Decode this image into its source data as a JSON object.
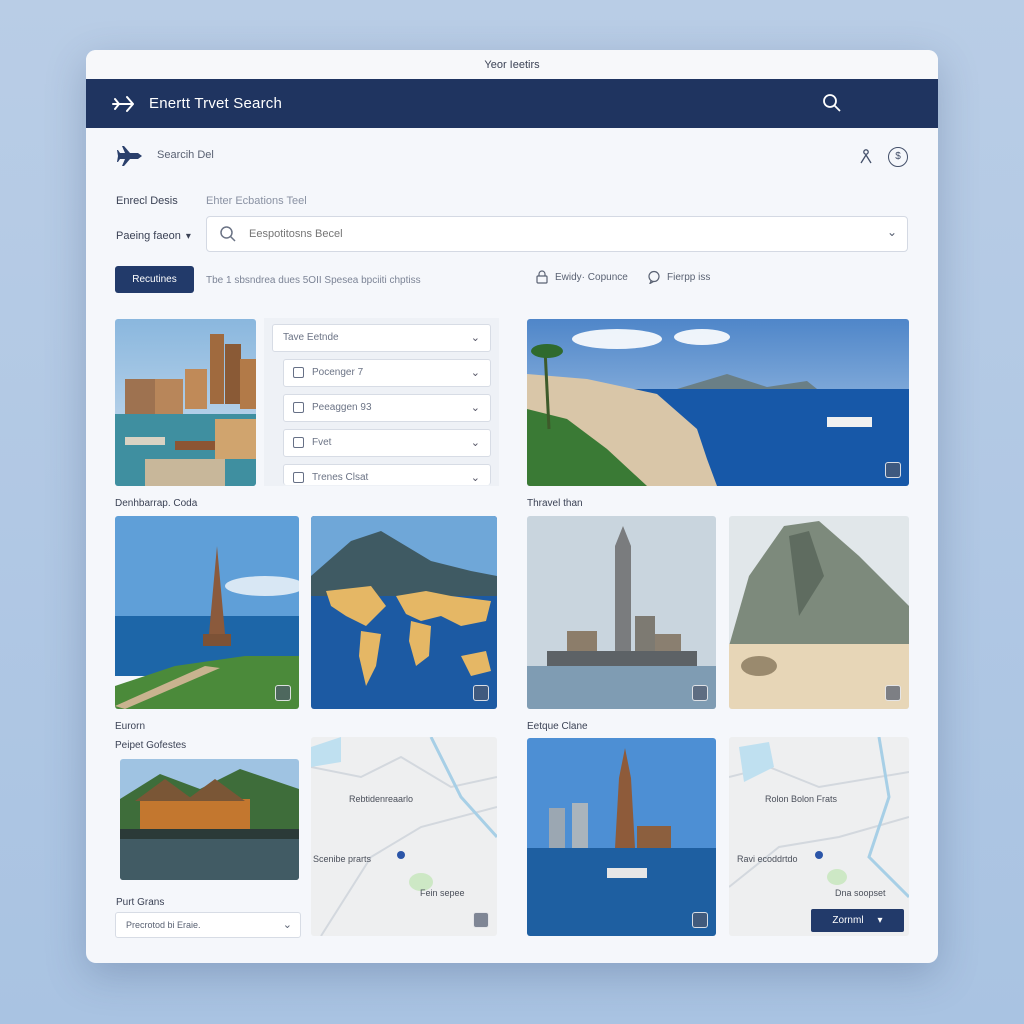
{
  "window": {
    "title": "Yeor Ieetirs"
  },
  "appbar": {
    "title": "Enertt Trvet Search"
  },
  "subheader": {
    "label": "Searcih Del"
  },
  "destination": {
    "label": "Enrecl Desis",
    "hint": "Ehter Ecbations Teel"
  },
  "filter": {
    "label": "Paeing faeon"
  },
  "search": {
    "placeholder": "Eespotitosns Becel"
  },
  "actions": {
    "primary_label": "Recutines",
    "description": "Tbe 1 sbsndrea dues 5OII Spesea bpciiti chptiss",
    "option1": "Ewidy· Copunce",
    "option2": "Fierpp iss"
  },
  "panel": {
    "selects": [
      "Tave Eetnde",
      "Pocenger 7",
      "Peeaggen 93",
      "Fvet",
      "Trenes Clsat"
    ]
  },
  "captions": {
    "c1": "Denhbarrap. Coda",
    "c2": "Thravel than",
    "c3": "Eurorn",
    "c3b": "Peipet Gofestes",
    "c4": "Eetque Clane",
    "c5": "Purt Grans"
  },
  "map1": {
    "labels": [
      "Rebtidenreaarlo",
      "Scenibe prarts",
      "Fein sepee"
    ]
  },
  "map2": {
    "labels": [
      "Rolon Bolon Frats",
      "Ravi ecoddrtdo",
      "Dna soopset"
    ]
  },
  "bottom": {
    "dropdown_value": "Precrotod bi Eraie.",
    "button_label": "Zornml"
  },
  "colors": {
    "brand": "#1f3460",
    "primary_button": "#223a6a",
    "background": "#adc6e3"
  }
}
